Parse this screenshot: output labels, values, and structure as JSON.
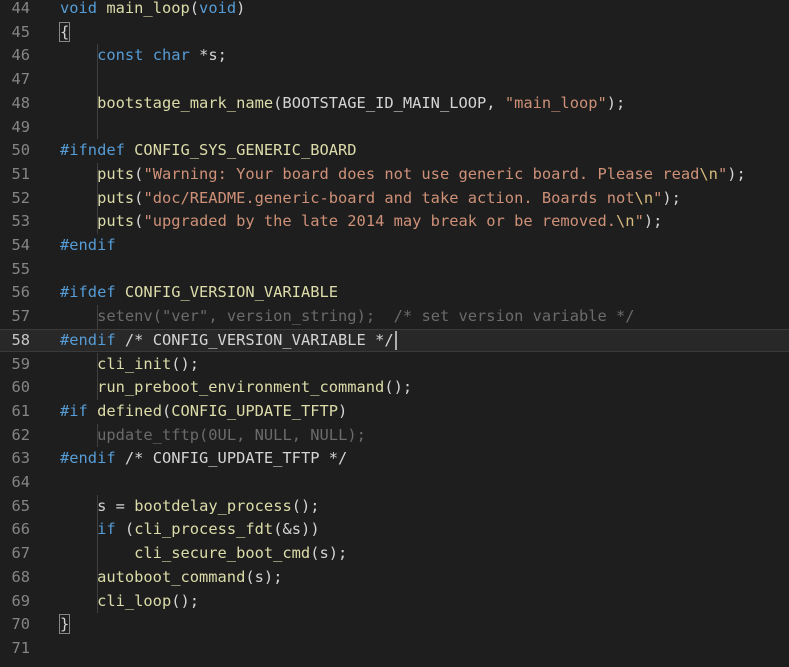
{
  "colors": {
    "background": "#1e1e1e",
    "line_number": "#858585",
    "default": "#d4d4d4",
    "keyword": "#569cd6",
    "function": "#dcdcaa",
    "string": "#ce9178",
    "escape": "#d7ba7d",
    "comment": "#6a9955",
    "punct": "#d4d4d4",
    "number": "#b5cea8",
    "inactive": "#6b6b6b",
    "macro": "#569cd6"
  },
  "editor": {
    "current_line": 58,
    "lines": [
      {
        "n": "44",
        "tokens": [
          [
            "void",
            "k"
          ],
          [
            " ",
            "d"
          ],
          [
            "main_loop",
            "f"
          ],
          [
            "(",
            "p"
          ],
          [
            "void",
            "k"
          ],
          [
            ")",
            "p"
          ]
        ]
      },
      {
        "n": "45",
        "tokens": [
          [
            "{",
            "p"
          ]
        ]
      },
      {
        "n": "46",
        "tokens": [
          [
            "    ",
            "d"
          ],
          [
            "const",
            "k"
          ],
          [
            " ",
            "d"
          ],
          [
            "char",
            "k"
          ],
          [
            " ",
            "d"
          ],
          [
            "*",
            "p"
          ],
          [
            "s",
            "d"
          ],
          [
            ";",
            "d"
          ]
        ]
      },
      {
        "n": "47",
        "tokens": []
      },
      {
        "n": "48",
        "tokens": [
          [
            "    ",
            "d"
          ],
          [
            "bootstage_mark_name",
            "f"
          ],
          [
            "(",
            "p"
          ],
          [
            "BOOTSTAGE_ID_MAIN_LOOP",
            "d"
          ],
          [
            ", ",
            "d"
          ],
          [
            "\"main_loop\"",
            "s"
          ],
          [
            ")",
            "p"
          ],
          [
            ";",
            "d"
          ]
        ]
      },
      {
        "n": "49",
        "tokens": []
      },
      {
        "n": "50",
        "tokens": [
          [
            "#ifndef",
            "k"
          ],
          [
            " ",
            "d"
          ],
          [
            "CONFIG_SYS_GENERIC_BOARD",
            "f"
          ]
        ]
      },
      {
        "n": "51",
        "tokens": [
          [
            "    ",
            "d"
          ],
          [
            "puts",
            "f"
          ],
          [
            "(",
            "p"
          ],
          [
            "\"Warning: Your board does not use generic board. Please read",
            "s"
          ],
          [
            "\\n",
            "e"
          ],
          [
            "\"",
            "s"
          ],
          [
            ")",
            "p"
          ],
          [
            ";",
            "d"
          ]
        ]
      },
      {
        "n": "52",
        "tokens": [
          [
            "    ",
            "d"
          ],
          [
            "puts",
            "f"
          ],
          [
            "(",
            "p"
          ],
          [
            "\"doc/README.generic-board and take action. Boards not",
            "s"
          ],
          [
            "\\n",
            "e"
          ],
          [
            "\"",
            "s"
          ],
          [
            ")",
            "p"
          ],
          [
            ";",
            "d"
          ]
        ]
      },
      {
        "n": "53",
        "tokens": [
          [
            "    ",
            "d"
          ],
          [
            "puts",
            "f"
          ],
          [
            "(",
            "p"
          ],
          [
            "\"upgraded by the late 2014 may break or be removed.",
            "s"
          ],
          [
            "\\n",
            "e"
          ],
          [
            "\"",
            "s"
          ],
          [
            ")",
            "p"
          ],
          [
            ";",
            "d"
          ]
        ]
      },
      {
        "n": "54",
        "tokens": [
          [
            "#endif",
            "k"
          ]
        ]
      },
      {
        "n": "55",
        "tokens": []
      },
      {
        "n": "56",
        "tokens": [
          [
            "#ifdef",
            "k"
          ],
          [
            " ",
            "d"
          ],
          [
            "CONFIG_VERSION_VARIABLE",
            "f"
          ]
        ]
      },
      {
        "n": "57",
        "tokens": [
          [
            "    ",
            "d"
          ],
          [
            "setenv",
            "i"
          ],
          [
            "(",
            "i"
          ],
          [
            "\"ver\"",
            "i"
          ],
          [
            ", version_string);  ",
            "i"
          ],
          [
            "/* set version variable */",
            "i"
          ]
        ]
      },
      {
        "n": "58",
        "tokens": [
          [
            "#endif",
            "k"
          ],
          [
            " ",
            "d"
          ],
          [
            "/* CONFIG_VERSION_VARIABLE */",
            "d"
          ]
        ]
      },
      {
        "n": "59",
        "tokens": [
          [
            "    ",
            "d"
          ],
          [
            "cli_init",
            "f"
          ],
          [
            "()",
            "p"
          ],
          [
            ";",
            "d"
          ]
        ]
      },
      {
        "n": "60",
        "tokens": [
          [
            "    ",
            "d"
          ],
          [
            "run_preboot_environment_command",
            "f"
          ],
          [
            "()",
            "p"
          ],
          [
            ";",
            "d"
          ]
        ]
      },
      {
        "n": "61",
        "tokens": [
          [
            "#if",
            "k"
          ],
          [
            " ",
            "d"
          ],
          [
            "defined",
            "f"
          ],
          [
            "(",
            "p"
          ],
          [
            "CONFIG_UPDATE_TFTP",
            "f"
          ],
          [
            ")",
            "p"
          ]
        ]
      },
      {
        "n": "62",
        "tokens": [
          [
            "    ",
            "d"
          ],
          [
            "update_tftp(",
            "i"
          ],
          [
            "0UL",
            "i"
          ],
          [
            ", ",
            "i"
          ],
          [
            "NULL",
            "i"
          ],
          [
            ", ",
            "i"
          ],
          [
            "NULL",
            "i"
          ],
          [
            ");",
            "i"
          ]
        ]
      },
      {
        "n": "63",
        "tokens": [
          [
            "#endif",
            "k"
          ],
          [
            " ",
            "d"
          ],
          [
            "/* CONFIG_UPDATE_TFTP */",
            "d"
          ]
        ]
      },
      {
        "n": "64",
        "tokens": []
      },
      {
        "n": "65",
        "tokens": [
          [
            "    ",
            "d"
          ],
          [
            "s",
            "d"
          ],
          [
            " ",
            "d"
          ],
          [
            "=",
            "p"
          ],
          [
            " ",
            "d"
          ],
          [
            "bootdelay_process",
            "f"
          ],
          [
            "()",
            "p"
          ],
          [
            ";",
            "d"
          ]
        ]
      },
      {
        "n": "66",
        "tokens": [
          [
            "    ",
            "d"
          ],
          [
            "if",
            "k"
          ],
          [
            " ",
            "d"
          ],
          [
            "(",
            "p"
          ],
          [
            "cli_process_fdt",
            "f"
          ],
          [
            "(",
            "p"
          ],
          [
            "&",
            "p"
          ],
          [
            "s",
            "d"
          ],
          [
            ")",
            "p"
          ],
          [
            ")",
            "p"
          ]
        ]
      },
      {
        "n": "67",
        "tokens": [
          [
            "        ",
            "d"
          ],
          [
            "cli_secure_boot_cmd",
            "f"
          ],
          [
            "(",
            "p"
          ],
          [
            "s",
            "d"
          ],
          [
            ")",
            "p"
          ],
          [
            ";",
            "d"
          ]
        ]
      },
      {
        "n": "68",
        "tokens": [
          [
            "    ",
            "d"
          ],
          [
            "autoboot_command",
            "f"
          ],
          [
            "(",
            "p"
          ],
          [
            "s",
            "d"
          ],
          [
            ")",
            "p"
          ],
          [
            ";",
            "d"
          ]
        ]
      },
      {
        "n": "69",
        "tokens": [
          [
            "    ",
            "d"
          ],
          [
            "cli_loop",
            "f"
          ],
          [
            "()",
            "p"
          ],
          [
            ";",
            "d"
          ]
        ]
      },
      {
        "n": "70",
        "tokens": [
          [
            "}",
            "p"
          ]
        ]
      },
      {
        "n": "71",
        "tokens": []
      }
    ]
  }
}
